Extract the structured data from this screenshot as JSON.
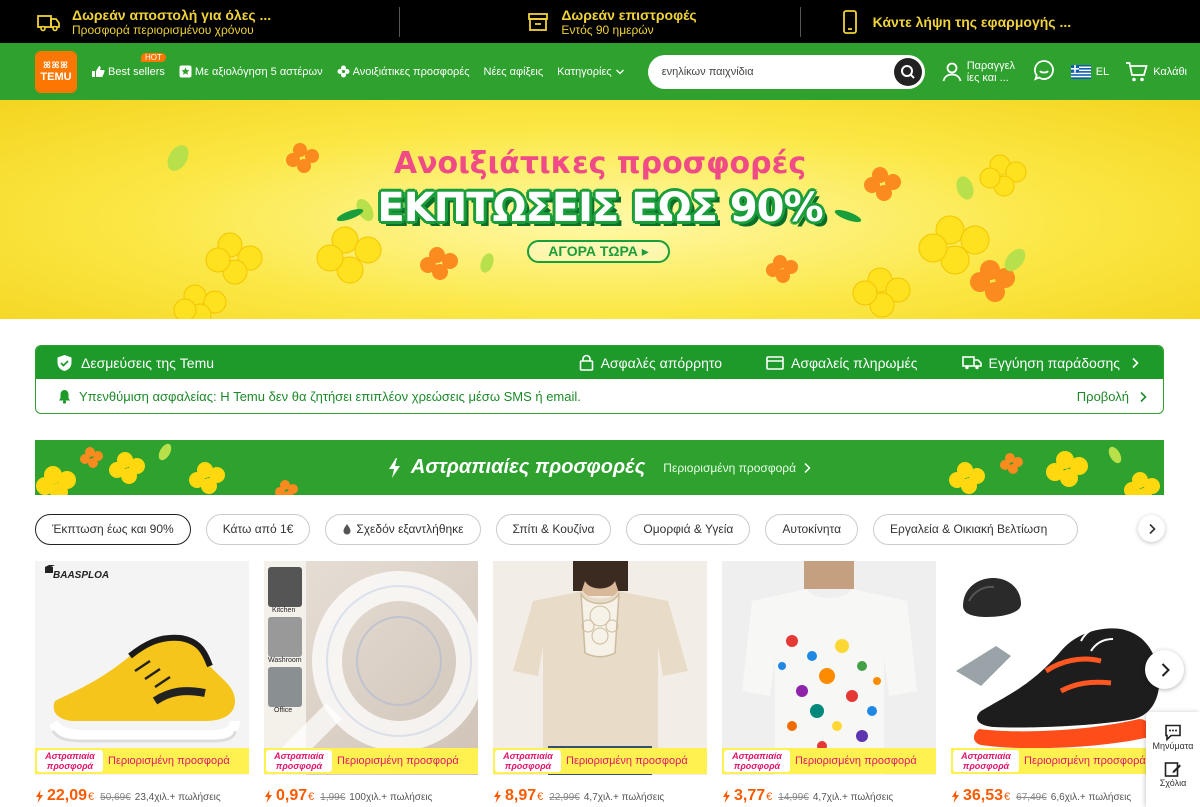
{
  "promo": [
    {
      "icon": "truck-icon",
      "line1": "Δωρεάν αποστολή για όλες ...",
      "line2": "Προσφορά περιορισμένου χρόνου"
    },
    {
      "icon": "return-box-icon",
      "line1": "Δωρεάν επιστροφές",
      "line2": "Εντός 90 ημερών"
    },
    {
      "icon": "phone-icon",
      "line1": "Κάντε λήψη της εφαρμογής ...",
      "line2": ""
    }
  ],
  "header": {
    "logo_top": "ꕤꕤꕤ",
    "logo_bottom": "TEMU",
    "nav": [
      {
        "label": "Best sellers",
        "icon": "thumbs-up-icon",
        "badge": "HOT"
      },
      {
        "label": "Με αξιολόγηση 5 αστέρων",
        "icon": "star-badge-icon"
      },
      {
        "label": "Ανοιξιάτικες προσφορές",
        "icon": "flower-icon"
      },
      {
        "label": "Νέες αφίξεις"
      },
      {
        "label": "Κατηγορίες",
        "icon": "chevron-down-icon"
      }
    ],
    "search_value": "ενηλίκων παιχνίδια",
    "orders_label": "Παραγγελ ίες και ...",
    "lang": "EL",
    "cart_label": "Καλάθι"
  },
  "hero": {
    "title": "Ανοιξιάτικες προσφορές",
    "headline": "ΕΚΠΤΩΣΕΙΣ ΕΩΣ 90%",
    "cta": "ΑΓΟΡΑ ΤΩΡΑ ▸"
  },
  "commitments": {
    "title": "Δεσμεύσεις της Temu",
    "items": [
      {
        "label": "Ασφαλές απόρρητο",
        "icon": "lock-icon"
      },
      {
        "label": "Ασφαλείς πληρωμές",
        "icon": "card-icon"
      },
      {
        "label": "Εγγύηση παράδοσης",
        "icon": "delivery-truck-icon"
      }
    ],
    "reminder": "Υπενθύμιση ασφαλείας: Η Temu δεν θα ζητήσει επιπλέον χρεώσεις μέσω SMS ή email.",
    "view": "Προβολή"
  },
  "deals": {
    "title": "Αστραπιαίες προσφορές",
    "subtitle": "Περιορισμένη προσφορά"
  },
  "chips": [
    "Έκπτωση έως και 90%",
    "Κάτω από 1€",
    "Σχεδόν εξαντλήθηκε",
    "Σπίτι & Κουζίνα",
    "Ομορφιά & Υγεία",
    "Αυτοκίνητα",
    "Εργαλεία & Οικιακή Βελτίωση"
  ],
  "products": [
    {
      "brand": "BAASPLOA",
      "price": "22,09",
      "currency": "€",
      "old": "50,69€",
      "sold": "23,4χιλ.+ πωλήσεις"
    },
    {
      "brand": "",
      "price": "0,97",
      "currency": "€",
      "old": "1,99€",
      "sold": "100χιλ.+ πωλήσεις",
      "labels": [
        "Kitchen",
        "Washroom",
        "Office"
      ]
    },
    {
      "brand": "",
      "price": "8,97",
      "currency": "€",
      "old": "22,99€",
      "sold": "4,7χιλ.+ πωλήσεις"
    },
    {
      "brand": "",
      "price": "3,77",
      "currency": "€",
      "old": "14,99€",
      "sold": "4,7χιλ.+ πωλήσεις"
    },
    {
      "brand": "",
      "price": "36,53",
      "currency": "€",
      "old": "67,49€",
      "sold": "6,6χιλ.+ πωλήσεις"
    }
  ],
  "product_tag": {
    "badge_line1": "Αστραπιαία",
    "badge_line2": "προσφορά",
    "text": "Περιορισμένη προσφορά"
  },
  "side_panel": {
    "messages": "Μηνύματα",
    "feedback": "Σχόλια"
  },
  "colors": {
    "header_green": "#2ea12e",
    "accent_orange": "#fb7701",
    "price_orange": "#fb5a01",
    "banner_yellow": "#fbe744",
    "pink": "#f04b87"
  }
}
